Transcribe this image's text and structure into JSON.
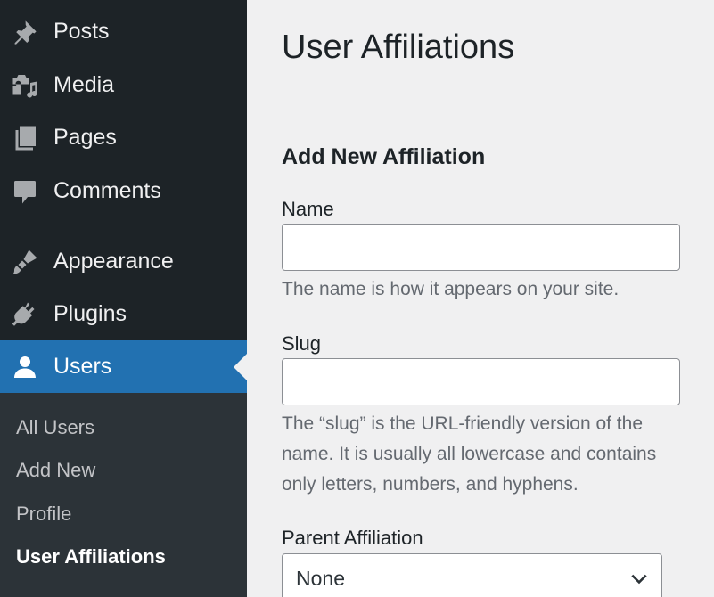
{
  "sidebar": {
    "items": [
      {
        "label": "Posts",
        "icon": "pushpin-icon"
      },
      {
        "label": "Media",
        "icon": "media-icon"
      },
      {
        "label": "Pages",
        "icon": "pages-icon"
      },
      {
        "label": "Comments",
        "icon": "comment-icon"
      },
      {
        "label": "Appearance",
        "icon": "paintbrush-icon"
      },
      {
        "label": "Plugins",
        "icon": "plugin-icon"
      },
      {
        "label": "Users",
        "icon": "user-icon"
      }
    ],
    "submenu": [
      {
        "label": "All Users"
      },
      {
        "label": "Add New"
      },
      {
        "label": "Profile"
      },
      {
        "label": "User Affiliations"
      }
    ]
  },
  "main": {
    "title": "User Affiliations",
    "section_title": "Add New Affiliation",
    "name": {
      "label": "Name",
      "value": "",
      "help": "The name is how it appears on your site."
    },
    "slug": {
      "label": "Slug",
      "value": "",
      "help_lines": [
        "The “slug” is the URL-friendly version of the",
        "name. It is usually all lowercase and contains",
        "only letters, numbers, and hyphens."
      ]
    },
    "parent": {
      "label": "Parent Affiliation",
      "selected": "None"
    }
  },
  "colors": {
    "sidebar_bg": "#1d2327",
    "submenu_bg": "#2c3338",
    "active_bg": "#2271b1",
    "content_bg": "#f0f0f1"
  }
}
